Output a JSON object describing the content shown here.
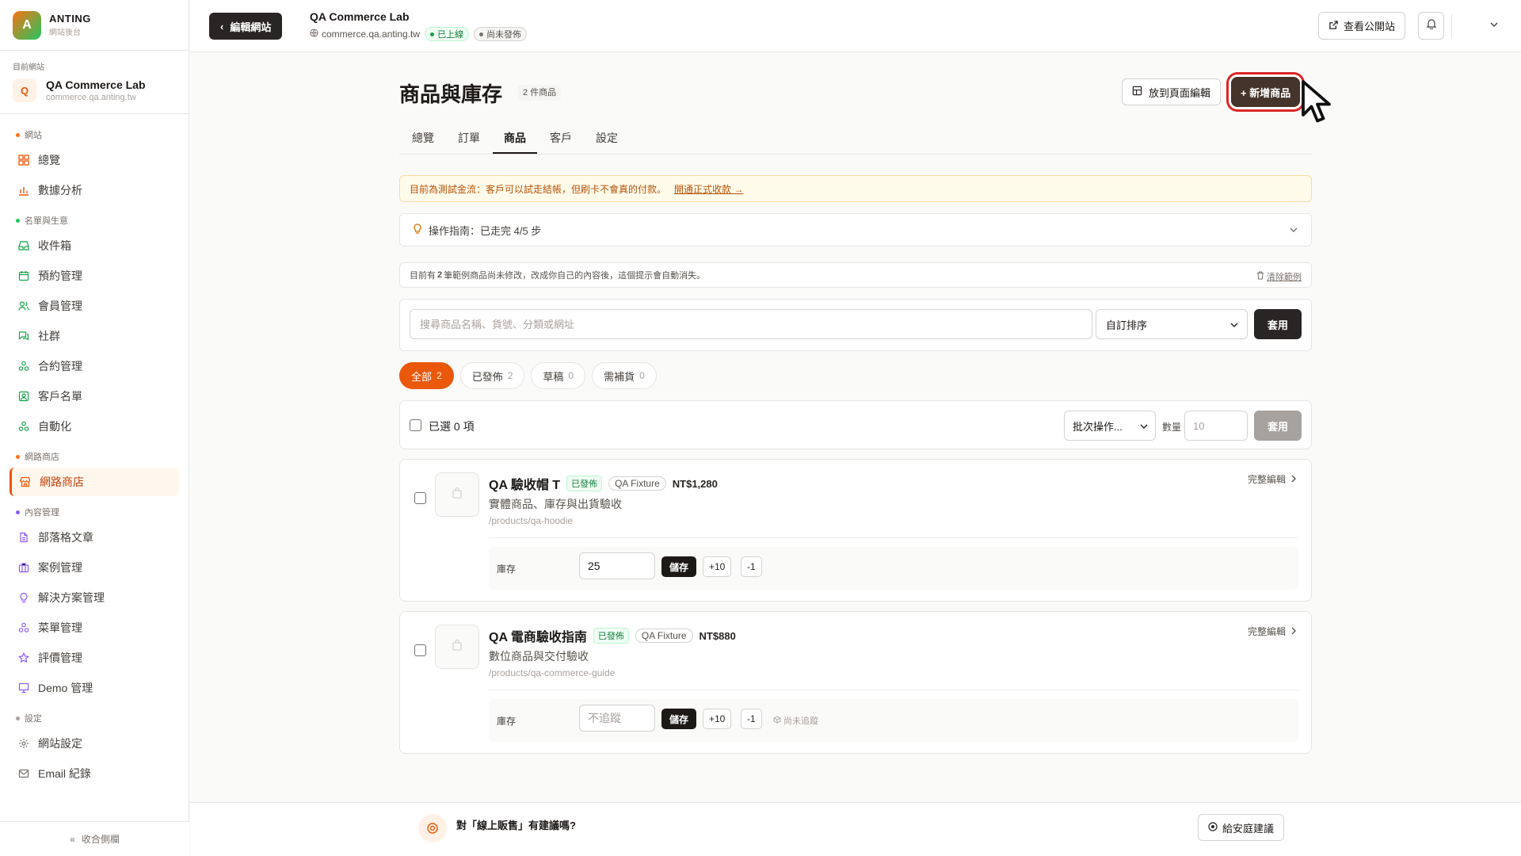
{
  "brand": {
    "logo_letter": "A",
    "name": "ANTING",
    "sub": "網站後台"
  },
  "current_site": {
    "label": "目前網站",
    "avatar": "Q",
    "name": "QA Commerce Lab",
    "domain": "commerce.qa.anting.tw"
  },
  "nav": {
    "groups": [
      {
        "label": "網站",
        "color": "#f97316",
        "items": [
          {
            "label": "總覽",
            "icon": "grid-icon"
          },
          {
            "label": "數據分析",
            "icon": "bar-chart-icon"
          }
        ]
      },
      {
        "label": "名單與生意",
        "color": "#22c55e",
        "items": [
          {
            "label": "收件箱",
            "icon": "inbox-icon"
          },
          {
            "label": "預約管理",
            "icon": "calendar-icon"
          },
          {
            "label": "會員管理",
            "icon": "users-icon"
          },
          {
            "label": "社群",
            "icon": "chat-icon"
          },
          {
            "label": "合約管理",
            "icon": "workflow-icon"
          },
          {
            "label": "客戶名單",
            "icon": "contact-icon"
          },
          {
            "label": "自動化",
            "icon": "automation-icon"
          }
        ]
      },
      {
        "label": "網路商店",
        "color": "#f97316",
        "items": [
          {
            "label": "網路商店",
            "icon": "store-icon",
            "active": true
          }
        ]
      },
      {
        "label": "內容管理",
        "color": "#8b5cf6",
        "items": [
          {
            "label": "部落格文章",
            "icon": "document-icon"
          },
          {
            "label": "案例管理",
            "icon": "briefcase-icon"
          },
          {
            "label": "解決方案管理",
            "icon": "lightbulb-icon"
          },
          {
            "label": "菜單管理",
            "icon": "menu-tree-icon"
          },
          {
            "label": "評價管理",
            "icon": "star-icon"
          },
          {
            "label": "Demo 管理",
            "icon": "presentation-icon"
          }
        ]
      },
      {
        "label": "設定",
        "color": "#a8a29e",
        "items": [
          {
            "label": "網站設定",
            "icon": "gear-icon"
          },
          {
            "label": "Email 紀錄",
            "icon": "mail-icon"
          }
        ]
      }
    ],
    "collapse_label": "收合側欄"
  },
  "topbar": {
    "back_label": "編輯網站",
    "site_title": "QA Commerce Lab",
    "site_domain": "commerce.qa.anting.tw",
    "status_live": "已上線",
    "status_unpublished": "尚未發佈",
    "view_site_label": "查看公開站"
  },
  "page": {
    "title": "商品與庫存",
    "count_badge": "2 件商品",
    "page_edit_label": "放到頁面編輯",
    "add_product_label": "+ 新增商品"
  },
  "tabs": [
    {
      "label": "總覽"
    },
    {
      "label": "訂單"
    },
    {
      "label": "商品",
      "active": true
    },
    {
      "label": "客戶"
    },
    {
      "label": "設定"
    }
  ],
  "notice": {
    "text": "目前為測試金流：客戶可以試走結帳，但刷卡不會真的付款。",
    "link": "開通正式收款 →"
  },
  "guide": {
    "text": "操作指南：已走完 4/5 步"
  },
  "sample": {
    "text_pre": "目前有 ",
    "count": "2",
    "text_post": " 筆範例商品尚未修改，改成你自己的內容後，這個提示會自動消失。",
    "clear_label": "清除範例"
  },
  "search": {
    "placeholder": "搜尋商品名稱、貨號、分類或網址",
    "sort_value": "自訂排序",
    "apply_label": "套用"
  },
  "filters": [
    {
      "label": "全部",
      "count": "2",
      "active": true
    },
    {
      "label": "已發佈",
      "count": "2"
    },
    {
      "label": "草稿",
      "count": "0"
    },
    {
      "label": "需補貨",
      "count": "0"
    }
  ],
  "bulk": {
    "selected_label": "已選 0 項",
    "action_value": "批次操作...",
    "qty_label": "數量",
    "qty_placeholder": "10",
    "apply_label": "套用"
  },
  "products": [
    {
      "name": "QA 驗收帽 T",
      "status": "已發佈",
      "tag": "QA Fixture",
      "price": "NT$1,280",
      "desc": "實體商品、庫存與出貨驗收",
      "slug": "/products/qa-hoodie",
      "edit_label": "完整編輯",
      "stock_label": "庫存",
      "stock_value": "25",
      "save_label": "儲存",
      "plus_label": "+10",
      "minus_label": "-1",
      "untracked_label": ""
    },
    {
      "name": "QA 電商驗收指南",
      "status": "已發佈",
      "tag": "QA Fixture",
      "price": "NT$880",
      "desc": "數位商品與交付驗收",
      "slug": "/products/qa-commerce-guide",
      "edit_label": "完整編輯",
      "stock_label": "庫存",
      "stock_placeholder": "不追蹤",
      "save_label": "儲存",
      "plus_label": "+10",
      "minus_label": "-1",
      "untracked_label": "尚未追蹤"
    }
  ],
  "feedback": {
    "title": "對「線上販售」有建議嗎?",
    "button_label": "給安庭建議"
  }
}
